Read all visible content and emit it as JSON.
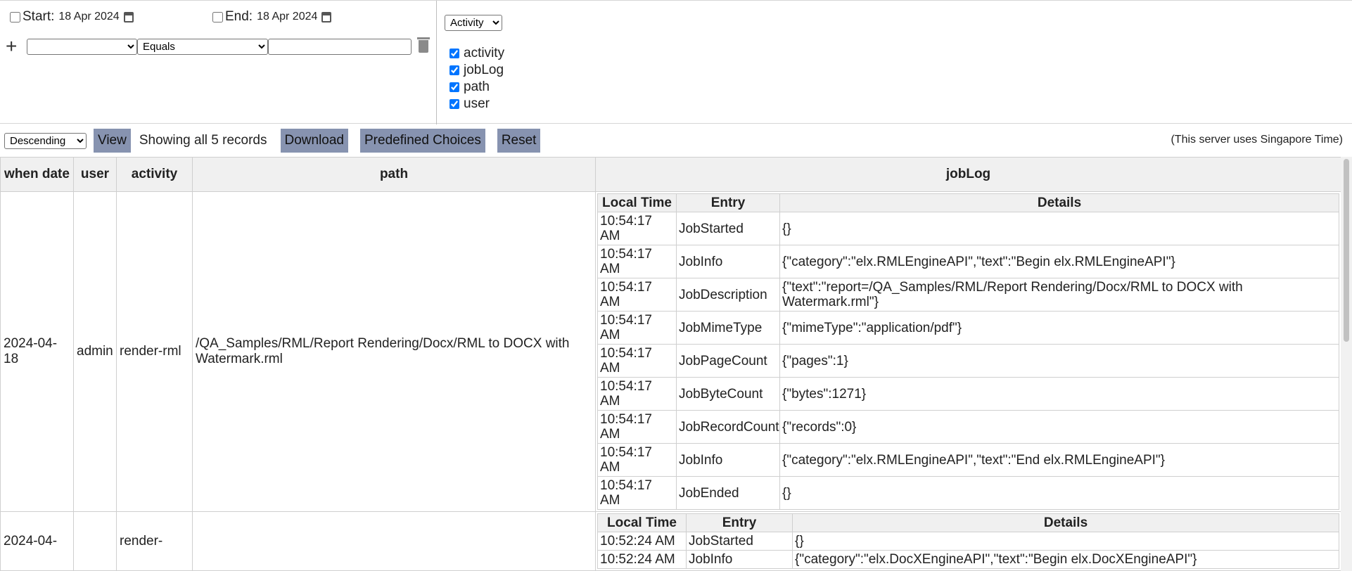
{
  "filters": {
    "start_label": "Start:",
    "start_date": "18 Apr 2024",
    "end_label": "End:",
    "end_date": "18 Apr 2024",
    "plus": "+",
    "operator": "Equals",
    "column_select": "Activity",
    "columns": [
      {
        "label": "activity",
        "checked": true
      },
      {
        "label": "jobLog",
        "checked": true
      },
      {
        "label": "path",
        "checked": true
      },
      {
        "label": "user",
        "checked": true
      }
    ]
  },
  "toolbar": {
    "order": "Descending",
    "view": "View",
    "showing": "Showing all 5 records",
    "download": "Download",
    "predefined": "Predefined Choices",
    "reset": "Reset",
    "server_note": "(This server uses Singapore Time)"
  },
  "table": {
    "headers": {
      "when": "when date",
      "user": "user",
      "activity": "activity",
      "path": "path",
      "joblog": "jobLog"
    },
    "log_headers": {
      "time": "Local Time",
      "entry": "Entry",
      "details": "Details"
    },
    "rows": [
      {
        "when": "2024-04-18",
        "user": "admin",
        "activity": "render-rml",
        "path": "/QA_Samples/RML/Report Rendering/Docx/RML to DOCX with Watermark.rml",
        "log": [
          {
            "time": "10:54:17 AM",
            "entry": "JobStarted",
            "details": "{}"
          },
          {
            "time": "10:54:17 AM",
            "entry": "JobInfo",
            "details": "{\"category\":\"elx.RMLEngineAPI\",\"text\":\"Begin elx.RMLEngineAPI\"}"
          },
          {
            "time": "10:54:17 AM",
            "entry": "JobDescription",
            "details": "{\"text\":\"report=/QA_Samples/RML/Report Rendering/Docx/RML to DOCX with Watermark.rml\"}"
          },
          {
            "time": "10:54:17 AM",
            "entry": "JobMimeType",
            "details": "{\"mimeType\":\"application/pdf\"}"
          },
          {
            "time": "10:54:17 AM",
            "entry": "JobPageCount",
            "details": "{\"pages\":1}"
          },
          {
            "time": "10:54:17 AM",
            "entry": "JobByteCount",
            "details": "{\"bytes\":1271}"
          },
          {
            "time": "10:54:17 AM",
            "entry": "JobRecordCount",
            "details": "{\"records\":0}"
          },
          {
            "time": "10:54:17 AM",
            "entry": "JobInfo",
            "details": "{\"category\":\"elx.RMLEngineAPI\",\"text\":\"End elx.RMLEngineAPI\"}"
          },
          {
            "time": "10:54:17 AM",
            "entry": "JobEnded",
            "details": "{}"
          }
        ]
      },
      {
        "when": "2024-04-",
        "user": "",
        "activity": "render-",
        "path": "",
        "log": [
          {
            "time": "10:52:24 AM",
            "entry": "JobStarted",
            "details": "{}"
          },
          {
            "time": "10:52:24 AM",
            "entry": "JobInfo",
            "details": "{\"category\":\"elx.DocXEngineAPI\",\"text\":\"Begin elx.DocXEngineAPI\"}"
          }
        ]
      }
    ]
  }
}
